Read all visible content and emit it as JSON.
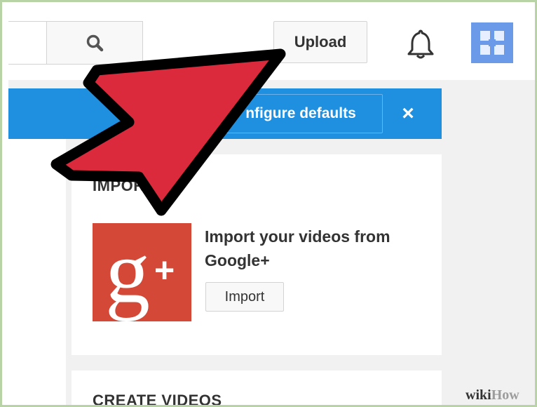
{
  "header": {
    "search_placeholder": "",
    "upload_label": "Upload"
  },
  "banner": {
    "button_label": "nfigure defaults",
    "close_label": "×"
  },
  "import_card": {
    "title": "IMPOR   EOS",
    "text": "Import your videos from Google+",
    "import_label": "Import"
  },
  "create_card": {
    "title": "CREATE VIDEOS"
  },
  "watermark": {
    "part1": "wiki",
    "part2": "How"
  },
  "icons": {
    "search": "search-icon",
    "notifications": "bell-icon",
    "avatar": "account-avatar-icon",
    "google_plus": "google-plus-logo",
    "pointer": "red-arrow-icon"
  },
  "colors": {
    "banner": "#1f8fe0",
    "google_plus": "#d34836",
    "arrow": "#dc2a3d",
    "avatar": "#6b9ae8"
  }
}
